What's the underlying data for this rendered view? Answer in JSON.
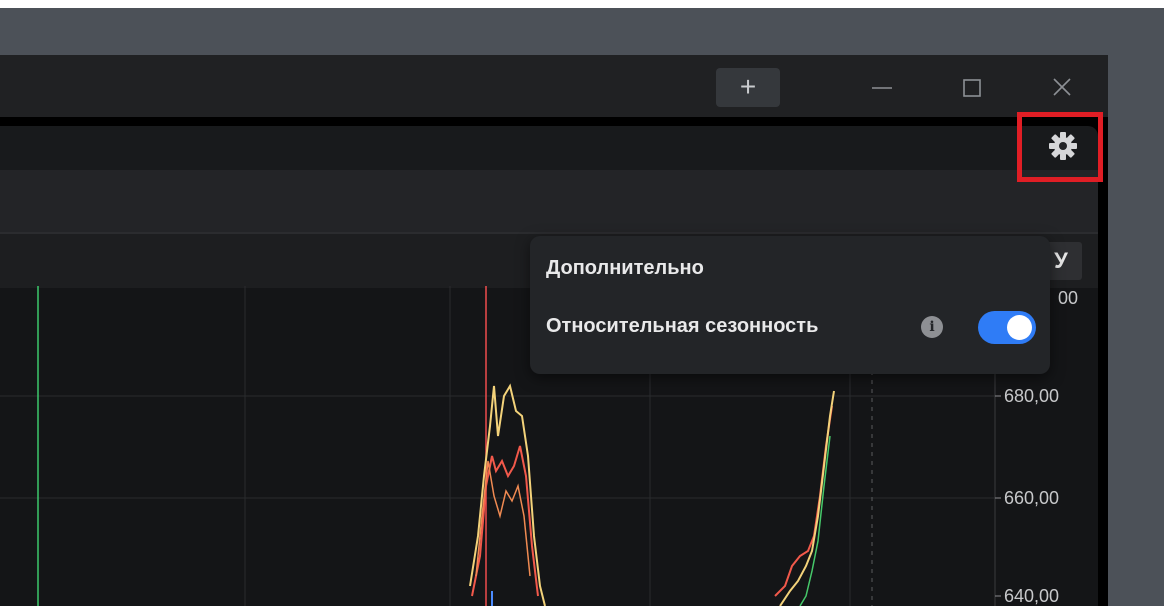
{
  "window": {
    "new_tab_label": "+"
  },
  "popover": {
    "title": "Дополнительно",
    "option_label": "Относительная сезонность",
    "option_enabled": true,
    "accent": "#2f7cf6"
  },
  "chart": {
    "ylabel_button": "У",
    "y_ticks": [
      "00",
      "680,00",
      "660,00",
      "640,00"
    ],
    "highlight_color": "#e01e25"
  }
}
